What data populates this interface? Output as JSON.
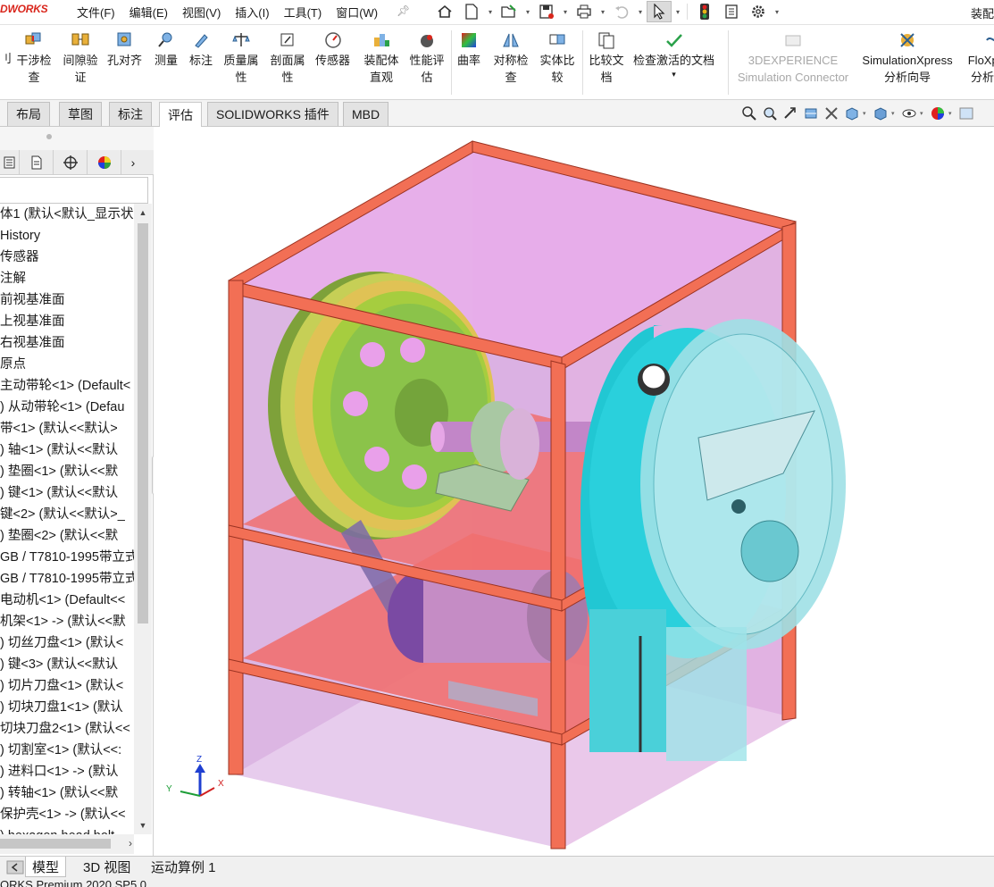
{
  "app": {
    "logo_text": "DWORKS",
    "title_right": "装配"
  },
  "menu": [
    {
      "label": "文件(F)"
    },
    {
      "label": "编辑(E)"
    },
    {
      "label": "视图(V)"
    },
    {
      "label": "插入(I)"
    },
    {
      "label": "工具(T)"
    },
    {
      "label": "窗口(W)"
    }
  ],
  "quick_access_icons": [
    "home-icon",
    "new-document-icon",
    "open-icon",
    "save-icon",
    "print-icon",
    "undo-icon",
    "select-cursor-icon",
    "rebuild-traffic-light-icon",
    "file-properties-icon",
    "options-gear-icon"
  ],
  "ribbon": {
    "edge_text": "刂",
    "buttons": [
      {
        "label": "干涉检查",
        "icon": "interference-check-icon"
      },
      {
        "label": "间隙验证",
        "icon": "clearance-verification-icon"
      },
      {
        "label": "孔对齐",
        "icon": "hole-alignment-icon"
      },
      {
        "label": "测量",
        "icon": "measure-icon"
      },
      {
        "label": "标注",
        "icon": "markup-icon"
      },
      {
        "label": "质量属性",
        "icon": "mass-properties-icon"
      },
      {
        "label": "剖面属性",
        "icon": "section-properties-icon"
      },
      {
        "label": "传感器",
        "icon": "sensor-icon"
      },
      {
        "label": "装配体直观",
        "icon": "assembly-visualization-icon"
      },
      {
        "label": "性能评估",
        "icon": "performance-evaluation-icon"
      },
      {
        "label": "曲率",
        "icon": "curvature-icon"
      },
      {
        "label": "对称检查",
        "icon": "symmetry-check-icon"
      },
      {
        "label": "实体比较",
        "icon": "compare-bodies-icon"
      },
      {
        "label": "比较文档",
        "icon": "compare-documents-icon"
      },
      {
        "label": "检查激活的文档",
        "icon": "check-active-document-icon"
      },
      {
        "label": "3DEXPERIENCE Simulation Connector",
        "icon": "simulation-connector-icon"
      },
      {
        "label": "SimulationXpress 分析向导",
        "icon": "simulationxpress-icon"
      },
      {
        "label": "FloXpress 分析向导",
        "icon": "floxpress-icon"
      }
    ]
  },
  "tabs": [
    {
      "label": "布局"
    },
    {
      "label": "草图"
    },
    {
      "label": "标注"
    },
    {
      "label": "评估"
    },
    {
      "label": "SOLIDWORKS 插件"
    },
    {
      "label": "MBD"
    }
  ],
  "active_tab": "评估",
  "heads_up_icons": [
    "zoom-to-fit-icon",
    "zoom-to-area-icon",
    "previous-view-icon",
    "section-view-icon",
    "dynamic-annotation-icon",
    "view-orientation-icon",
    "display-style-icon",
    "hide-show-icon",
    "appearance-icon"
  ],
  "tree": {
    "items": [
      "体1  (默认<默认_显示状",
      "History",
      "传感器",
      "注解",
      "前视基准面",
      "上视基准面",
      "右视基准面",
      "原点",
      "主动带轮<1> (Default<",
      ") 从动带轮<1> (Defau",
      "带<1> (默认<<默认>",
      ") 轴<1> (默认<<默认",
      ") 垫圈<1> (默认<<默",
      ") 键<1> (默认<<默认",
      "键<2> (默认<<默认>_",
      ") 垫圈<2> (默认<<默",
      "GB / T7810-1995带立式",
      "GB / T7810-1995带立式",
      "电动机<1> (Default<<",
      "机架<1> -> (默认<<默",
      ") 切丝刀盘<1> (默认<",
      ") 键<3> (默认<<默认",
      ") 切片刀盘<1> (默认<",
      ") 切块刀盘1<1> (默认",
      "切块刀盘2<1> (默认<<",
      ") 切割室<1> (默认<<:",
      ") 进料口<1> -> (默认",
      ") 转轴<1> (默认<<默",
      "保护壳<1> -> (默认<<",
      ") hexagon head bolt"
    ]
  },
  "triad": {
    "x": "X",
    "y": "Y",
    "z": "Z"
  },
  "bottom_tabs": [
    {
      "label": "模型"
    },
    {
      "label": "3D 视图"
    },
    {
      "label": "运动算例 1"
    }
  ],
  "status_text": "ORKS Premium 2020 SP5.0"
}
